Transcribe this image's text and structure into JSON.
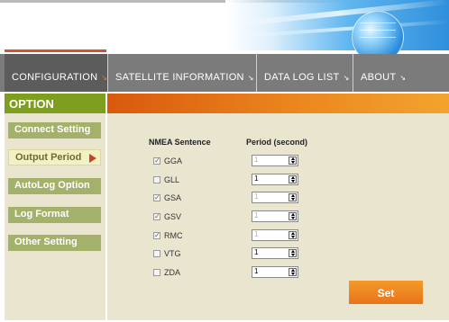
{
  "nav": {
    "items": [
      {
        "label": "CONFIGURATION"
      },
      {
        "label": "SATELLITE  INFORMATION"
      },
      {
        "label": "DATA  LOG  LIST"
      },
      {
        "label": "ABOUT"
      }
    ],
    "active_index": 0,
    "arrow_glyph": "↘"
  },
  "sidebar": {
    "title": "OPTION",
    "items": [
      {
        "label": "Connect  Setting"
      },
      {
        "label": "Output  Period"
      },
      {
        "label": "AutoLog  Option"
      },
      {
        "label": "Log  Format"
      },
      {
        "label": "Other  Setting"
      }
    ],
    "active_index": 1
  },
  "content": {
    "col_sentence": "NMEA Sentence",
    "col_period": "Period (second)",
    "rows": [
      {
        "name": "GGA",
        "checked": true,
        "value": "1",
        "enabled": false
      },
      {
        "name": "GLL",
        "checked": false,
        "value": "1",
        "enabled": true
      },
      {
        "name": "GSA",
        "checked": true,
        "value": "1",
        "enabled": false
      },
      {
        "name": "GSV",
        "checked": true,
        "value": "1",
        "enabled": false
      },
      {
        "name": "RMC",
        "checked": true,
        "value": "1",
        "enabled": false
      },
      {
        "name": "VTG",
        "checked": false,
        "value": "1",
        "enabled": true
      },
      {
        "name": "ZDA",
        "checked": false,
        "value": "1",
        "enabled": true
      }
    ],
    "check_glyph": "✓",
    "set_label": "Set"
  },
  "colors": {
    "nav_bg": "#7b7b7b",
    "sidebar_title": "#7d9e1e",
    "accent_orange": "#e8741a",
    "panel_bg": "#e9e5cf"
  }
}
